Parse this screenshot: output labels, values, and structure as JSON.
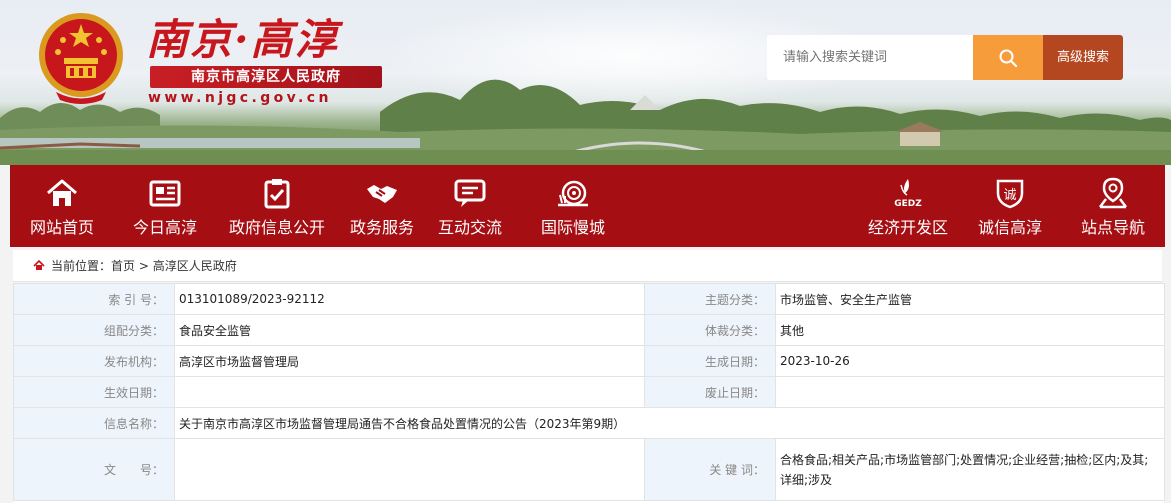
{
  "site": {
    "title": "南京·高淳",
    "subtitle": "南京市高淳区人民政府",
    "url": "www.njgc.gov.cn"
  },
  "search": {
    "placeholder": "请输入搜索关键词",
    "advanced_label": "高级搜索",
    "icon": "search-icon"
  },
  "nav": {
    "items": [
      {
        "label": "网站首页",
        "icon": "home-icon"
      },
      {
        "label": "今日高淳",
        "icon": "newspaper-icon"
      },
      {
        "label": "政府信息公开",
        "icon": "clipboard-check-icon"
      },
      {
        "label": "政务服务",
        "icon": "handshake-icon"
      },
      {
        "label": "互动交流",
        "icon": "chat-icon"
      },
      {
        "label": "国际慢城",
        "icon": "snail-icon"
      },
      {
        "label": "经济开发区",
        "icon": "gedz-logo-icon",
        "logo_text": "GEDZ"
      },
      {
        "label": "诚信高淳",
        "icon": "integrity-shield-icon",
        "logo_text": "诚"
      },
      {
        "label": "站点导航",
        "icon": "location-pin-icon"
      }
    ]
  },
  "breadcrumb": {
    "prefix": "当前位置：",
    "home": "首页",
    "separator": ">",
    "current": "高淳区人民政府"
  },
  "info": {
    "index_label": "索 引 号：",
    "index_value": "013101089/2023-92112",
    "topic_label": "主题分类：",
    "topic_value": "市场监管、安全生产监管",
    "category_label": "组配分类：",
    "category_value": "食品安全监管",
    "genre_label": "体裁分类：",
    "genre_value": "其他",
    "publisher_label": "发布机构：",
    "publisher_value": "高淳区市场监督管理局",
    "created_label": "生成日期：",
    "created_value": "2023-10-26",
    "effective_label": "生效日期：",
    "effective_value": "",
    "abolished_label": "废止日期：",
    "abolished_value": "",
    "name_label": "信息名称：",
    "name_value": "关于南京市高淳区市场监督管理局通告不合格食品处置情况的公告（2023年第9期）",
    "docno_label": "文　　号：",
    "docno_value": "",
    "keywords_label": "关 键 词：",
    "keywords_value": "合格食品;相关产品;市场监管部门;处置情况;企业经营;抽检;区内;及其;详细;涉及"
  },
  "colors": {
    "nav_red": "#a50e12",
    "brand_red": "#c8161d",
    "search_orange": "#f79c3b",
    "advanced_brown": "#b54720",
    "label_bg": "#eef4fb"
  }
}
